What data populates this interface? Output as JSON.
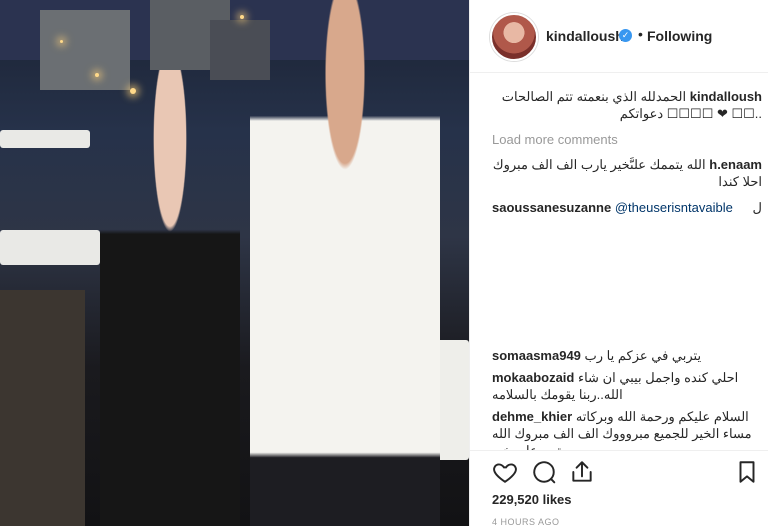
{
  "post": {
    "username": "kindalloush",
    "follow_status": "Following",
    "caption_text": "الحمدلله الذي بنعمته تتم الصالحات ..☐☐ ❤ ☐☐☐☐ دعواتكم",
    "load_more_label": "Load more comments",
    "likes": "229,520 likes",
    "timestamp": "4 HOURS AGO"
  },
  "comments": [
    {
      "user": "h.enaam",
      "text": "الله يتممك علىَّخير يارب الف الف مبروك احلا كندا"
    },
    {
      "user": "saoussanesuzanne",
      "mention": "@theuserisntavaible",
      "text": "ل"
    },
    {
      "user": "somaasma949",
      "text": "يتربي في عزكم يا رب"
    },
    {
      "user": "mokaabozaid",
      "text": "احلي كنده واجمل بيبي ان شاء الله..ربنا يقومك بالسلامه"
    },
    {
      "user": "dehme_khier",
      "text": "السلام عليكم ورحمة الله وبركاته مساء الخير للجميع مبروووك الف الف مبروك الله يتمم على خير"
    }
  ]
}
